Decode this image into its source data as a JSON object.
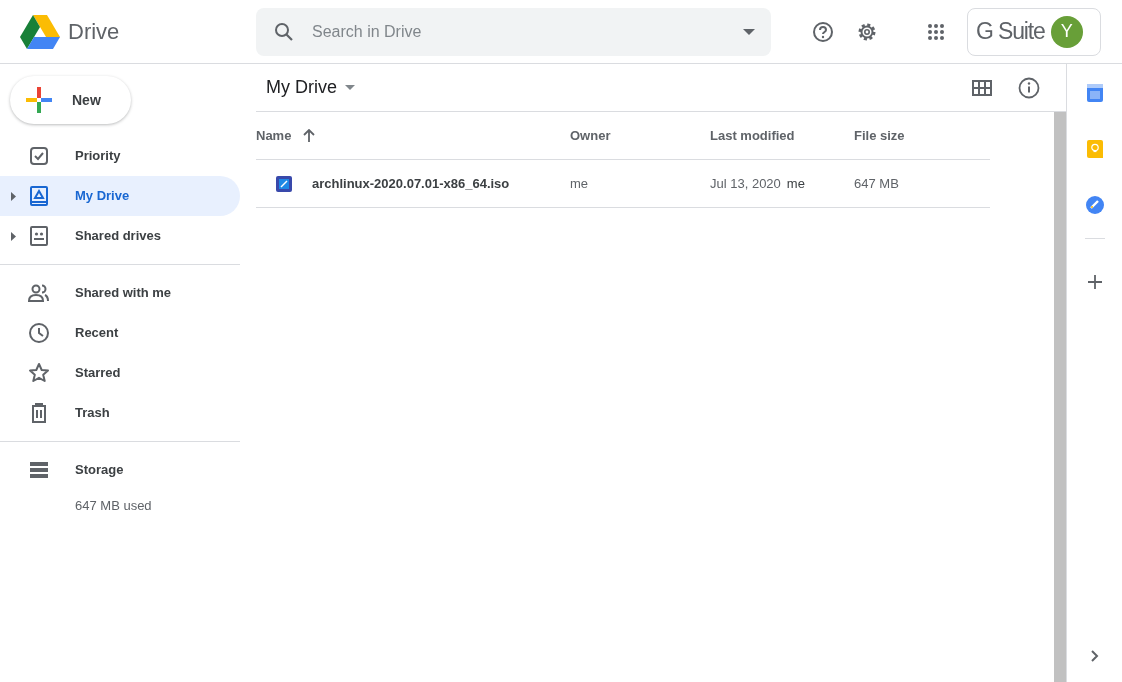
{
  "header": {
    "app_name": "Drive",
    "search": {
      "placeholder": "Search in Drive"
    },
    "suite_label": "G Suite",
    "avatar_letter": "Y"
  },
  "new_button": {
    "label": "New"
  },
  "sidebar": {
    "groups": [
      [
        {
          "kind": "priority",
          "label": "Priority",
          "selected": false,
          "expandable": false
        },
        {
          "kind": "my_drive",
          "label": "My Drive",
          "selected": true,
          "expandable": true
        },
        {
          "kind": "shared_drives",
          "label": "Shared drives",
          "selected": false,
          "expandable": true
        }
      ],
      [
        {
          "kind": "shared",
          "label": "Shared with me",
          "selected": false,
          "expandable": false
        },
        {
          "kind": "recent",
          "label": "Recent",
          "selected": false,
          "expandable": false
        },
        {
          "kind": "starred",
          "label": "Starred",
          "selected": false,
          "expandable": false
        },
        {
          "kind": "trash",
          "label": "Trash",
          "selected": false,
          "expandable": false
        }
      ],
      [
        {
          "kind": "storage",
          "label": "Storage",
          "selected": false,
          "expandable": false
        }
      ]
    ],
    "storage_used": "647 MB used"
  },
  "breadcrumb": "My Drive",
  "table": {
    "columns": [
      "Name",
      "Owner",
      "Last modified",
      "File size"
    ],
    "rows": [
      {
        "name": "archlinux-2020.07.01-x86_64.iso",
        "owner": "me",
        "modified_date": "Jul 13, 2020",
        "modified_by": "me",
        "size": "647 MB"
      }
    ]
  }
}
